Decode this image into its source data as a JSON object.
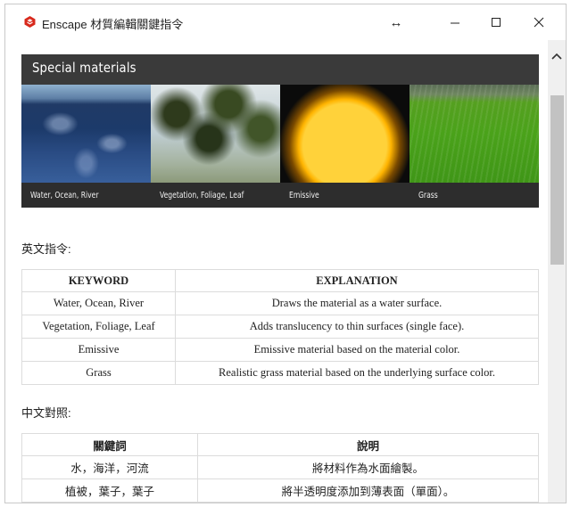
{
  "window": {
    "title": "Enscape 材質編輯關鍵指令",
    "resize_glyph": "↔",
    "minimize_glyph": "—",
    "close_glyph": "✕"
  },
  "banner": {
    "title": "Special materials",
    "tiles": [
      {
        "caption": "Water, Ocean, River",
        "image": "water-ocean-image"
      },
      {
        "caption": "Vegetation, Foliage, Leaf",
        "image": "vegetation-tree-image"
      },
      {
        "caption": "Emissive",
        "image": "glowing-sphere-image"
      },
      {
        "caption": "Grass",
        "image": "grass-field-image"
      }
    ]
  },
  "english": {
    "heading": "英文指令:",
    "headers": [
      "KEYWORD",
      "EXPLANATION"
    ],
    "rows": [
      [
        "Water, Ocean, River",
        "Draws the material as a water surface."
      ],
      [
        "Vegetation, Foliage, Leaf",
        "Adds translucency to thin surfaces (single face)."
      ],
      [
        "Emissive",
        "Emissive material based on the material color."
      ],
      [
        "Grass",
        "Realistic grass material based on the underlying surface color."
      ]
    ]
  },
  "chinese": {
    "heading": "中文對照:",
    "headers": [
      "關鍵詞",
      "說明"
    ],
    "rows": [
      [
        "水，海洋，河流",
        "將材料作為水面繪製。"
      ],
      [
        "植被，葉子，葉子",
        "將半透明度添加到薄表面（單面）。"
      ]
    ]
  },
  "colors": {
    "banner_bg": "#3a3a3a",
    "app_icon_red": "#d8291c",
    "table_border": "#dcdcdc",
    "scroll_thumb": "#c2c2c2"
  },
  "icons": {
    "app": "enscape-app-icon",
    "resize": "horizontal-resize-icon",
    "minimize": "minimize-icon",
    "maximize": "maximize-icon",
    "close": "close-icon",
    "scroll_up": "chevron-up-icon"
  }
}
